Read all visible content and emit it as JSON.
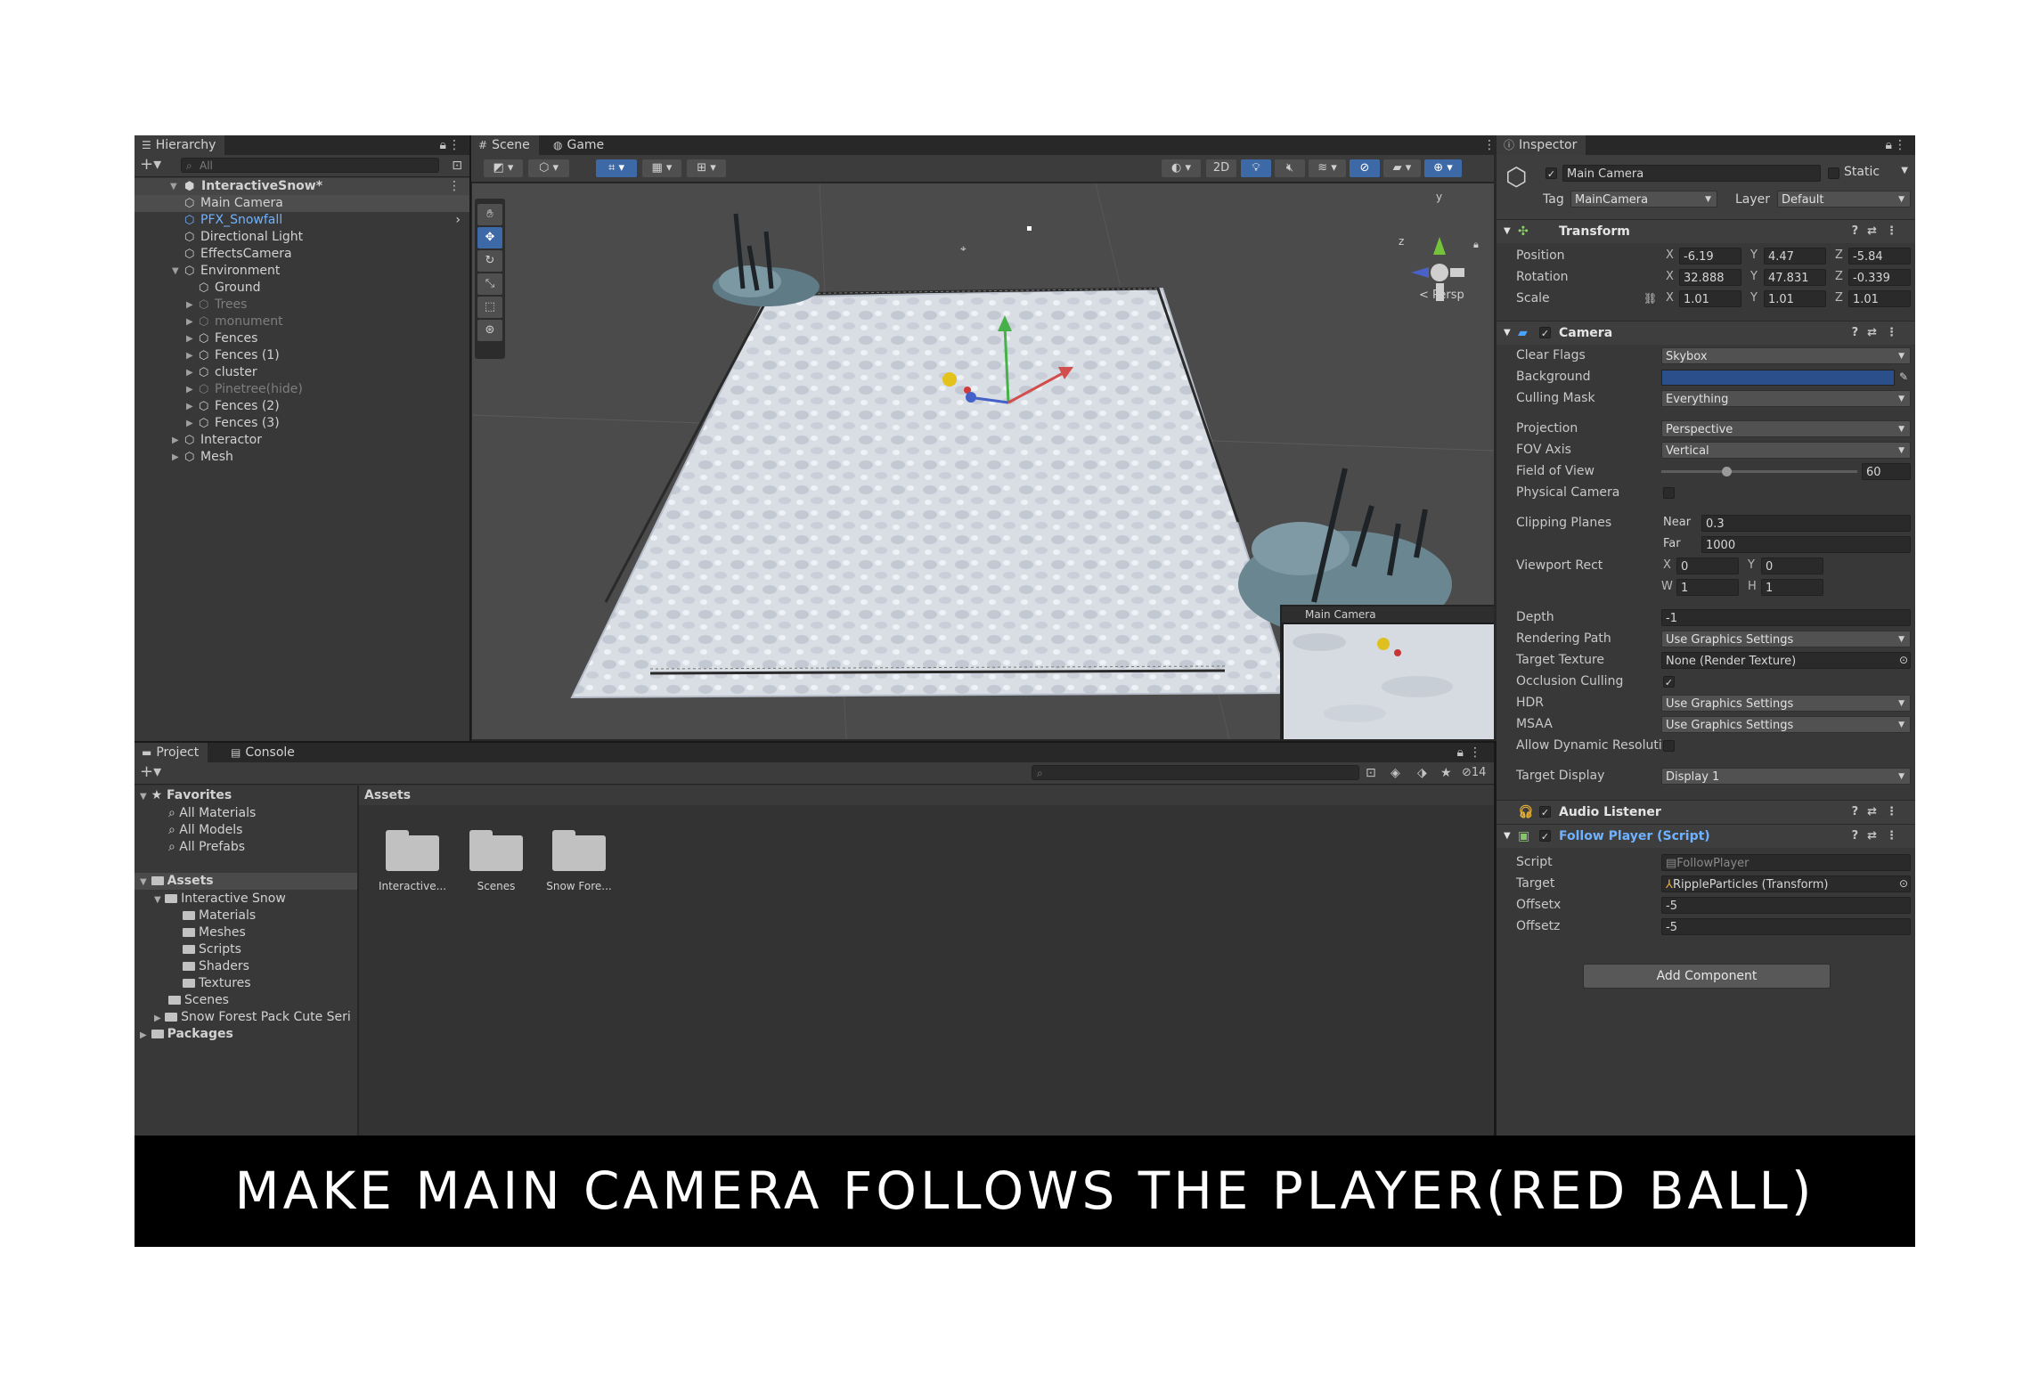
{
  "hierarchy": {
    "tab": "Hierarchy",
    "search_placeholder": "All",
    "scene_name": "InteractiveSnow*",
    "items": [
      {
        "label": "Main Camera",
        "state": "selected"
      },
      {
        "label": "PFX_Snowfall",
        "state": "prefab"
      },
      {
        "label": "Directional Light",
        "state": "normal"
      },
      {
        "label": "EffectsCamera",
        "state": "normal"
      },
      {
        "label": "Environment",
        "state": "normal"
      },
      {
        "label": "Ground",
        "state": "normal"
      },
      {
        "label": "Trees",
        "state": "disabled"
      },
      {
        "label": "monument",
        "state": "disabled"
      },
      {
        "label": "Fences",
        "state": "normal"
      },
      {
        "label": "Fences (1)",
        "state": "normal"
      },
      {
        "label": "cluster",
        "state": "normal"
      },
      {
        "label": "Pinetree(hide)",
        "state": "disabled"
      },
      {
        "label": "Fences (2)",
        "state": "normal"
      },
      {
        "label": "Fences (3)",
        "state": "normal"
      },
      {
        "label": "Interactor",
        "state": "normal"
      },
      {
        "label": "Mesh",
        "state": "normal"
      }
    ]
  },
  "scene_view": {
    "tabs": [
      "Scene",
      "Game"
    ],
    "toggle_2d": "2D",
    "persp_label": "< Persp",
    "gizmo_y": "y",
    "gizmo_z": "z",
    "camera_preview_title": "Main Camera"
  },
  "project": {
    "tabs": [
      "Project",
      "Console"
    ],
    "hidden_count": "14",
    "favorites": {
      "label": "Favorites",
      "items": [
        "All Materials",
        "All Models",
        "All Prefabs"
      ]
    },
    "assets_root": "Assets",
    "assets_tree": [
      "Interactive Snow",
      "Materials",
      "Meshes",
      "Scripts",
      "Shaders",
      "Textures",
      "Scenes",
      "Snow Forest Pack Cute Seri"
    ],
    "packages": "Packages",
    "breadcrumb": "Assets",
    "grid_items": [
      "Interactive...",
      "Scenes",
      "Snow Fore..."
    ]
  },
  "inspector": {
    "tab": "Inspector",
    "object_name": "Main Camera",
    "static_label": "Static",
    "tag_label": "Tag",
    "tag_value": "MainCamera",
    "layer_label": "Layer",
    "layer_value": "Default",
    "transform": {
      "title": "Transform",
      "position_label": "Position",
      "position": {
        "x": "-6.19",
        "y": "4.47",
        "z": "-5.84"
      },
      "rotation_label": "Rotation",
      "rotation": {
        "x": "32.888",
        "y": "47.831",
        "z": "-0.339"
      },
      "scale_label": "Scale",
      "scale": {
        "x": "1.01",
        "y": "1.01",
        "z": "1.01"
      }
    },
    "camera": {
      "title": "Camera",
      "clear_flags_label": "Clear Flags",
      "clear_flags": "Skybox",
      "background_label": "Background",
      "background_color": "#2a4f8a",
      "culling_mask_label": "Culling Mask",
      "culling_mask": "Everything",
      "projection_label": "Projection",
      "projection": "Perspective",
      "fov_axis_label": "FOV Axis",
      "fov_axis": "Vertical",
      "fov_label": "Field of View",
      "fov": "60",
      "fov_fraction": 0.33,
      "physical_label": "Physical Camera",
      "clipping_label": "Clipping Planes",
      "near_label": "Near",
      "near": "0.3",
      "far_label": "Far",
      "far": "1000",
      "viewport_label": "Viewport Rect",
      "vp_x": "0",
      "vp_y": "0",
      "vp_w": "1",
      "vp_h": "1",
      "depth_label": "Depth",
      "depth": "-1",
      "rendering_path_label": "Rendering Path",
      "rendering_path": "Use Graphics Settings",
      "target_texture_label": "Target Texture",
      "target_texture": "None (Render Texture)",
      "occlusion_label": "Occlusion Culling",
      "hdr_label": "HDR",
      "hdr": "Use Graphics Settings",
      "msaa_label": "MSAA",
      "msaa": "Use Graphics Settings",
      "dynamic_res_label": "Allow Dynamic Resoluti",
      "target_display_label": "Target Display",
      "target_display": "Display 1"
    },
    "audio_listener": {
      "title": "Audio Listener"
    },
    "follow_player": {
      "title": "Follow Player (Script)",
      "script_label": "Script",
      "script": "FollowPlayer",
      "target_label": "Target",
      "target": "RippleParticles (Transform)",
      "offsetx_label": "Offsetx",
      "offsetx": "-5",
      "offsetz_label": "Offsetz",
      "offsetz": "-5"
    },
    "add_component": "Add Component"
  },
  "caption": "MAKE MAIN CAMERA FOLLOWS THE PLAYER(RED BALL)"
}
